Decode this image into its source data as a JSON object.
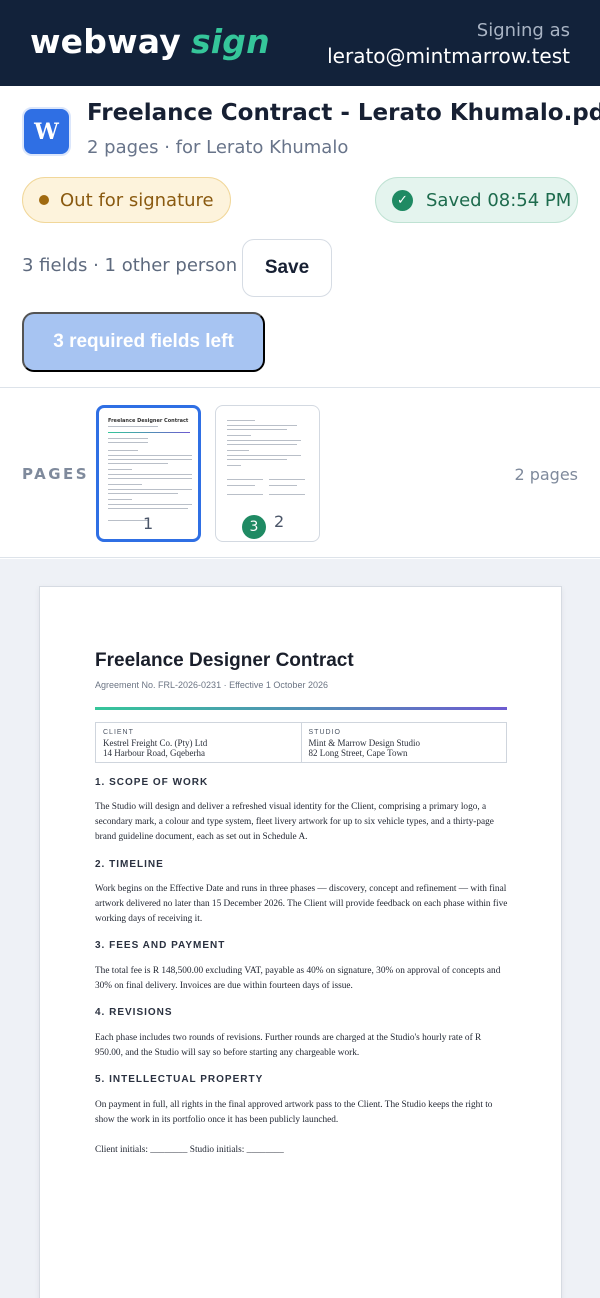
{
  "app": {
    "logo_word": "webway",
    "logo_sign": "sign",
    "signing_label": "Signing as",
    "signing_email": "lerato@mintmarrow.test"
  },
  "document": {
    "icon_letter": "W",
    "title": "Freelance Contract - Lerato Khumalo.pdf",
    "subtitle": "2 pages · for Lerato Khumalo",
    "status": "Out for signature",
    "saved": "Saved 08:54 PM",
    "fields_summary": "3 fields · 1 other person",
    "save_label": "Save",
    "required_label": "3 required fields left",
    "colors": {
      "primary": "#2f6fe4",
      "accent": "#35c69a",
      "topbar": "#12223a",
      "success": "#1f8a63"
    }
  },
  "pages": {
    "label": "PAGES",
    "count": "2 pages",
    "thumbs": [
      {
        "number": "1",
        "title": "Freelance Designer Contract"
      },
      {
        "number": "2",
        "badge": "3"
      }
    ]
  },
  "contract": {
    "title": "Freelance Designer Contract",
    "meta": "Agreement No. FRL-2026-0231 · Effective 1 October 2026",
    "client_label": "CLIENT",
    "client_name": "Kestrel Freight Co. (Pty) Ltd",
    "client_address": "14 Harbour Road, Gqeberha",
    "studio_label": "STUDIO",
    "studio_name": "Mint & Marrow Design Studio",
    "studio_address": "82 Long Street, Cape Town",
    "sections": [
      {
        "heading": "1. SCOPE OF WORK",
        "text": "The Studio will design and deliver a refreshed visual identity for the Client, comprising a primary logo, a secondary mark, a colour and type system, fleet livery artwork for up to six vehicle types, and a thirty-page brand guideline document, each as set out in Schedule A."
      },
      {
        "heading": "2. TIMELINE",
        "text": "Work begins on the Effective Date and runs in three phases — discovery, concept and refinement — with final artwork delivered no later than 15 December 2026. The Client will provide feedback on each phase within five working days of receiving it."
      },
      {
        "heading": "3. FEES AND PAYMENT",
        "text": "The total fee is R 148,500.00 excluding VAT, payable as 40% on signature, 30% on approval of concepts and 30% on final delivery. Invoices are due within fourteen days of issue."
      },
      {
        "heading": "4. REVISIONS",
        "text": "Each phase includes two rounds of revisions. Further rounds are charged at the Studio's hourly rate of R 950.00, and the Studio will say so before starting any chargeable work."
      },
      {
        "heading": "5. INTELLECTUAL PROPERTY",
        "text": "On payment in full, all rights in the final approved artwork pass to the Client. The Studio keeps the right to show the work in its portfolio once it has been publicly launched."
      }
    ],
    "initials": "Client initials: ________      Studio initials: ________"
  }
}
